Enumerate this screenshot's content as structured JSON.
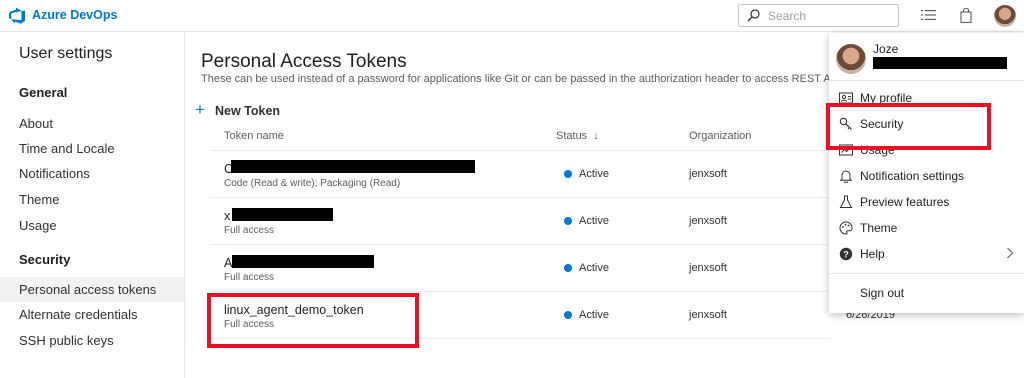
{
  "app": {
    "brand": "Azure DevOps"
  },
  "search": {
    "placeholder": "Search"
  },
  "nav": {
    "title": "User settings",
    "sections": [
      {
        "heading": "General",
        "items": [
          "About",
          "Time and Locale",
          "Notifications",
          "Theme",
          "Usage"
        ]
      },
      {
        "heading": "Security",
        "items": [
          "Personal access tokens",
          "Alternate credentials",
          "SSH public keys"
        ]
      }
    ]
  },
  "main": {
    "title": "Personal Access Tokens",
    "subtitle": "These can be used instead of a password for applications like Git or can be passed in the authorization header to access REST A",
    "new_token": "New Token",
    "columns": {
      "name": "Token name",
      "status": "Status",
      "sort_indicator": "↓",
      "organization": "Organization"
    },
    "rows": [
      {
        "name": "C",
        "scope": "Code (Read & write); Packaging (Read)",
        "status": "Active",
        "organization": "jenxsoft",
        "date": ""
      },
      {
        "name": "x",
        "scope": "Full access",
        "status": "Active",
        "organization": "jenxsoft",
        "date": ""
      },
      {
        "name": "A",
        "scope": "Full access",
        "status": "Active",
        "organization": "jenxsoft",
        "date": ""
      },
      {
        "name": "linux_agent_demo_token",
        "scope": "Full access",
        "status": "Active",
        "organization": "jenxsoft",
        "date": "6/26/2019"
      }
    ]
  },
  "menu": {
    "user_name": "Joze",
    "items": [
      "My profile",
      "Security",
      "Usage",
      "Notification settings",
      "Preview features",
      "Theme",
      "Help"
    ],
    "sign_out": "Sign out"
  },
  "colors": {
    "accent": "#0078d4",
    "highlight": "#e81123",
    "redaction": "#000000"
  },
  "icons": {
    "brand": "azure-devops-logo",
    "search": "search-icon",
    "topbar": [
      "list-icon",
      "shopping-bag-icon"
    ],
    "menu": [
      "contact-card-icon",
      "key-icon",
      "chart-icon",
      "bell-icon",
      "flask-icon",
      "palette-icon",
      "help-icon"
    ]
  }
}
